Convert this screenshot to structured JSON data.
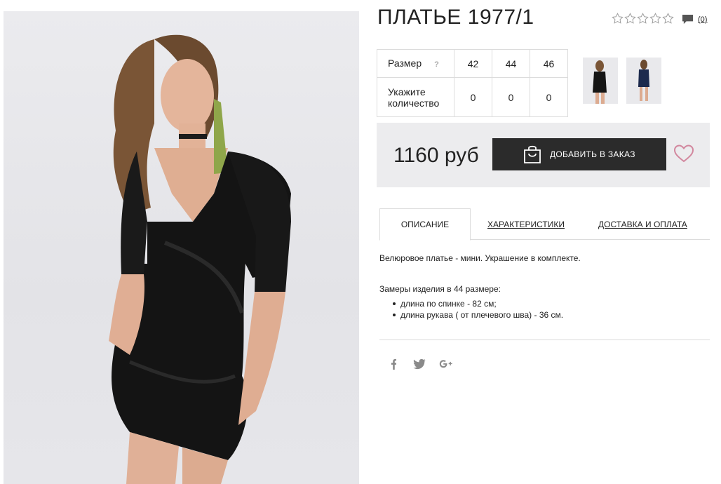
{
  "product": {
    "title": "ПЛАТЬЕ 1977/1",
    "review_count": "(0)",
    "price": "1160 руб"
  },
  "sizes": {
    "size_label": "Размер",
    "help": "?",
    "values": [
      "42",
      "44",
      "46"
    ],
    "qty_label_line1": "Укажите",
    "qty_label_line2": "количество",
    "quantities": [
      "0",
      "0",
      "0"
    ]
  },
  "actions": {
    "add_to_order": "ДОБАВИТЬ В ЗАКАЗ"
  },
  "tabs": [
    {
      "label": "ОПИСАНИЕ",
      "active": true
    },
    {
      "label": "ХАРАКТЕРИСТИКИ",
      "active": false
    },
    {
      "label": "ДОСТАВКА И ОПЛАТА",
      "active": false
    }
  ],
  "description": {
    "text": "Велюровое платье - мини. Украшение в комплекте.",
    "measurements_title": "Замеры изделия в 44 размере:",
    "measurements": [
      "длина по спинке - 82 см;",
      "длина рукава ( от плечевого шва) - 36 см."
    ]
  },
  "rating": {
    "value": 0,
    "max": 5
  },
  "colors": {
    "button_bg": "#2b2b2b",
    "panel_bg": "#ececee",
    "heart": "#d2879e",
    "icons": "#8a8a8a"
  },
  "icons": {
    "stars": "star-outline-icon",
    "comments": "comment-icon",
    "cart": "shopping-bag-icon",
    "wishlist": "heart-icon",
    "social": [
      "facebook-icon",
      "twitter-icon",
      "google-plus-icon"
    ]
  }
}
